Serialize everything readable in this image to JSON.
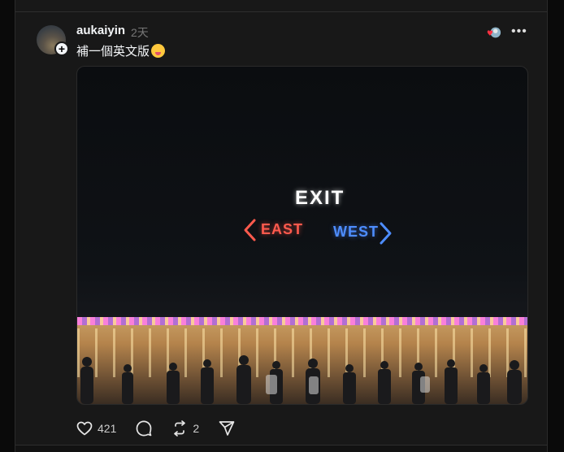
{
  "post": {
    "username": "aukaiyin",
    "time": "2天",
    "text": "補一個英文版",
    "photo": {
      "sign_exit": "EXIT",
      "sign_east": "EAST",
      "sign_west": "WEST"
    }
  },
  "actions": {
    "likes": "421",
    "reposts": "2"
  },
  "icons": {
    "follow": "plus-icon",
    "more": "more-icon",
    "like": "heart-icon",
    "comment": "comment-icon",
    "repost": "repost-icon",
    "share": "send-icon"
  },
  "colors": {
    "background": "#181818",
    "text": "#f3f5f7",
    "muted": "#777777",
    "east": "#ff5a4d",
    "west": "#4d8dff"
  }
}
